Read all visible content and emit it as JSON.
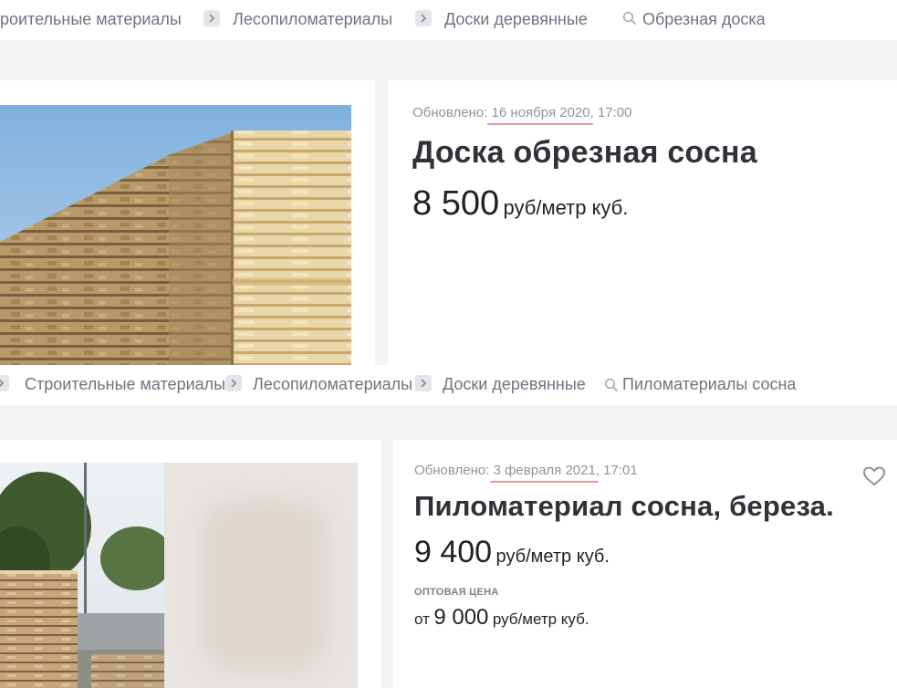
{
  "listing1": {
    "breadcrumb": [
      "роительные материалы",
      "Лесопиломатериалы",
      "Доски деревянные",
      "Обрезная доска"
    ],
    "updated_label": "Обновлено:",
    "updated_date": "16 ноября 2020",
    "updated_time": ", 17:00",
    "title": "Доска обрезная сосна",
    "price": "8 500",
    "price_unit": "руб/метр куб."
  },
  "listing2": {
    "breadcrumb": [
      "Строительные материалы",
      "Лесопиломатериалы",
      "Доски деревянные",
      "Пиломатериалы сосна"
    ],
    "updated_label": "Обновлено:",
    "updated_date": "3 февраля 2021",
    "updated_time": ", 17:01",
    "title": "Пиломатериал сосна, береза.",
    "price": "9 400",
    "price_unit": "руб/метр куб.",
    "wholesale_label": "ОПТОВАЯ ЦЕНА",
    "wholesale_from": "от",
    "wholesale_price": "9 000",
    "wholesale_unit": "руб/метр куб."
  },
  "icons": {
    "separator": "chevron-right-icon",
    "search": "search-icon",
    "favorite": "heart-outline-icon"
  },
  "colors": {
    "page_background": "#f3f4f6",
    "card_background": "#ffffff",
    "date_underline": "#ee9a9a",
    "breadcrumb_text": "#6d7480"
  }
}
